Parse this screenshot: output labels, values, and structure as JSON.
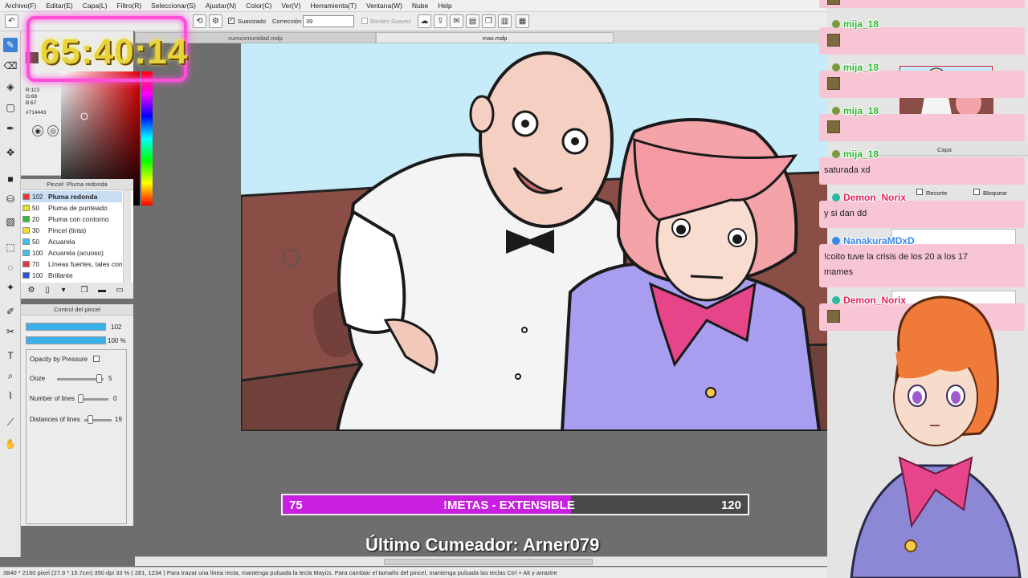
{
  "menu": [
    "Archivo(F)",
    "Editar(E)",
    "Capa(L)",
    "Filtro(R)",
    "Seleccionar(S)",
    "Ajustar(N)",
    "Color(C)",
    "Ver(V)",
    "Herramienta(T)",
    "Ventana(W)",
    "Nube",
    "Help"
  ],
  "toolbar": {
    "smoothing_label": "Suavizado",
    "correction_label": "Corrección",
    "correction_value": "39",
    "soft_edges_label": "Bordes Suaves"
  },
  "color": {
    "r": "R:113",
    "g": "G:68",
    "b": "B:67",
    "hex": "#714443",
    "current": "#714443"
  },
  "brush_panel": {
    "title": "Pincel: Pluma redonda",
    "items": [
      {
        "size": "102",
        "name": "Pluma redonda",
        "color": "#e83838",
        "selected": true
      },
      {
        "size": "50",
        "name": "Pluma de punteado",
        "color": "#f0e020"
      },
      {
        "size": "20",
        "name": "Pluma con contorno",
        "color": "#30c030"
      },
      {
        "size": "30",
        "name": "Pincel (tinta)",
        "color": "#f0e020"
      },
      {
        "size": "50",
        "name": "Acuarela",
        "color": "#40c0f0"
      },
      {
        "size": "100",
        "name": "Acuarela (acuoso)",
        "color": "#40c0f0"
      },
      {
        "size": "70",
        "name": "Líneas fuertes, tales como",
        "color": "#e83838"
      },
      {
        "size": "100",
        "name": "Brillante",
        "color": "#3050e0"
      }
    ]
  },
  "brush_control": {
    "title": "Control del pincel",
    "size_value": "102",
    "opacity_value": "100 %",
    "opacity_pressure_label": "Opacity by Pressure",
    "ooze_label": "Ooze",
    "ooze_value": "5",
    "lines_label": "Number of lines",
    "lines_value": "0",
    "distance_label": "Distances of lines",
    "distance_value": "19"
  },
  "tabs": [
    "cumcomunidad.mdp",
    "max.mdp"
  ],
  "timer": "65:40:14",
  "goal": {
    "start": "75",
    "label": "!METAS - EXTENSIBLE",
    "end": "120",
    "fraction": 0.62
  },
  "last_cumeador": "Último Cumeador: Arner079",
  "statusbar": "3840 * 2160 pixel   (27.9 * 15.7cm)   350 dpi   33 %   ( 281, 1234 )   Para trazar una línea recta, mantenga pulsada la tecla Mayús. Para cambiar el tamaño del pincel, mantenga pulsada las teclas Ctrl + Alt y arrastre",
  "layer_panel": {
    "title": "Capa",
    "clip_label": "Recorte",
    "lock_label": "Bloquear"
  },
  "chat": [
    {
      "user": "mija_18",
      "text": "",
      "color": "#2bb82b"
    },
    {
      "user": "mija_18",
      "text": "",
      "color": "#2bb82b"
    },
    {
      "user": "mija_18",
      "text": "",
      "color": "#2bb82b"
    },
    {
      "user": "mija_18",
      "text": "saturada xd",
      "color": "#2bb82b"
    },
    {
      "user": "Demon_Norix",
      "text": "y si dan dd",
      "color": "#e2245a"
    },
    {
      "user": "NanakuraMDxD",
      "text": "!coito tuve la crisis de los 20 a los 17",
      "text2": "mames",
      "color": "#3a86e8"
    },
    {
      "user": "Demon_Norix",
      "text": "",
      "color": "#e2245a"
    }
  ],
  "icons": [
    "undo-icon",
    "brush-icon",
    "eraser-icon",
    "hand-icon",
    "text-icon",
    "move-icon"
  ]
}
